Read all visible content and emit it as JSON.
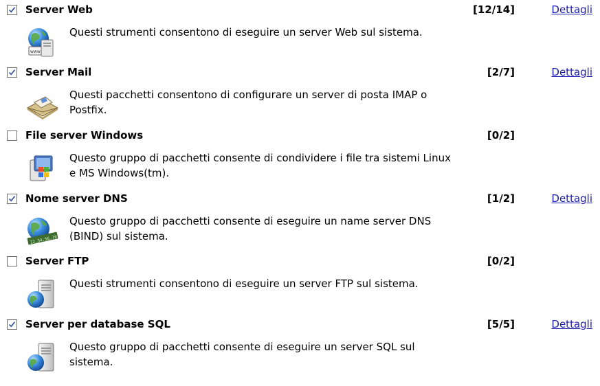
{
  "details_label": "Dettagli",
  "groups": [
    {
      "id": "web-server",
      "checked": true,
      "title": "Server Web",
      "count": "[12/14]",
      "has_details": true,
      "description": "Questi strumenti consentono di eseguire un server Web sul sistema.",
      "icon": "web-server-icon"
    },
    {
      "id": "mail-server",
      "checked": true,
      "title": "Server Mail",
      "count": "[2/7]",
      "has_details": true,
      "description": "Questi pacchetti consentono di configurare un server di posta IMAP o Postfix.",
      "icon": "mail-server-icon"
    },
    {
      "id": "windows-file-server",
      "checked": false,
      "title": "File server Windows",
      "count": "[0/2]",
      "has_details": false,
      "description": "Questo gruppo di pacchetti consente di condividere i file tra sistemi Linux e MS Windows(tm).",
      "icon": "windows-file-server-icon"
    },
    {
      "id": "dns-server",
      "checked": true,
      "title": "Nome server DNS",
      "count": "[1/2]",
      "has_details": true,
      "description": "Questo gruppo di pacchetti consente di eseguire un name server DNS (BIND) sul sistema.",
      "icon": "dns-globe-icon"
    },
    {
      "id": "ftp-server",
      "checked": false,
      "title": "Server FTP",
      "count": "[0/2]",
      "has_details": false,
      "description": "Questi strumenti consentono di eseguire un server FTP sul sistema.",
      "icon": "ftp-server-icon"
    },
    {
      "id": "sql-server",
      "checked": true,
      "title": "Server per database SQL",
      "count": "[5/5]",
      "has_details": true,
      "description": "Questo gruppo di pacchetti consente di eseguire un server SQL sul sistema.",
      "icon": "sql-server-icon"
    }
  ],
  "dns_icon_label": "12.34.56.78"
}
